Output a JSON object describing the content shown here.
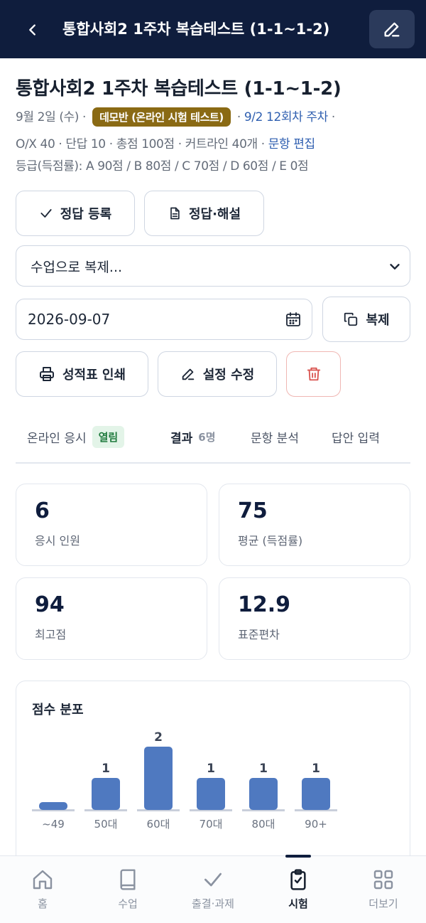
{
  "header": {
    "title": "통합사회2 1주차 복습테스트 (1-1~1-2)"
  },
  "page": {
    "title": "통합사회2 1주차 복습테스트 (1-1~1-2)",
    "meta_date": "9월 2일 (수) ·",
    "meta_badge": "데모반 (온라인 시험 테스트)",
    "meta_session_sep": " · ",
    "meta_session": "9/2 12회차 주차",
    "meta_session_tail": " ·",
    "meta_composition": "O/X 40 · 단답 10 · 총점 100점 · 커트라인 40개 · ",
    "meta_edit_link": "문항 편집",
    "meta_grades": "등급(득점률): A 90점 / B 80점 / C 70점 / D 60점 / E 0점"
  },
  "actions": {
    "register_answers": "정답 등록",
    "answers_explanations": "정답·해설",
    "copy_select_value": "수업으로 복제...",
    "date_value": "2026-09-07",
    "copy_button": "복제",
    "print_report": "성적표 인쇄",
    "edit_settings": "설정 수정"
  },
  "tabs": {
    "online": "온라인 응시",
    "online_badge": "열림",
    "results": "결과",
    "results_count": "6명",
    "item_analysis": "문항 분석",
    "answer_entry": "답안 입력"
  },
  "stats": [
    {
      "value": "6",
      "label": "응시 인원"
    },
    {
      "value": "75",
      "label": "평균 (득점률)"
    },
    {
      "value": "94",
      "label": "최고점"
    },
    {
      "value": "12.9",
      "label": "표준편차"
    }
  ],
  "chart_data": {
    "type": "bar",
    "title": "점수 분포",
    "categories": [
      "~49",
      "50대",
      "60대",
      "70대",
      "80대",
      "90+"
    ],
    "values": [
      0,
      1,
      2,
      1,
      1,
      1
    ],
    "data_labels": [
      "",
      "1",
      "2",
      "1",
      "1",
      "1"
    ],
    "ylim": [
      0,
      2
    ],
    "grid": false,
    "colors": {
      "bar": "#4f79c0",
      "baseline": "#c9cfdb"
    }
  },
  "nav": {
    "items": [
      {
        "label": "홈",
        "icon": "home-icon"
      },
      {
        "label": "수업",
        "icon": "book-icon"
      },
      {
        "label": "출결·과제",
        "icon": "check-icon"
      },
      {
        "label": "시험",
        "icon": "clipboard-check-icon"
      },
      {
        "label": "더보기",
        "icon": "grid-icon"
      }
    ],
    "active_index": 3
  },
  "colors": {
    "header_bg": "#0f1d3d",
    "badge_demo": "#8a6a14",
    "link": "#2f5fb0",
    "open_badge_bg": "#e3f4e8",
    "open_badge_text": "#1f7a3d",
    "delete": "#d9534f"
  }
}
